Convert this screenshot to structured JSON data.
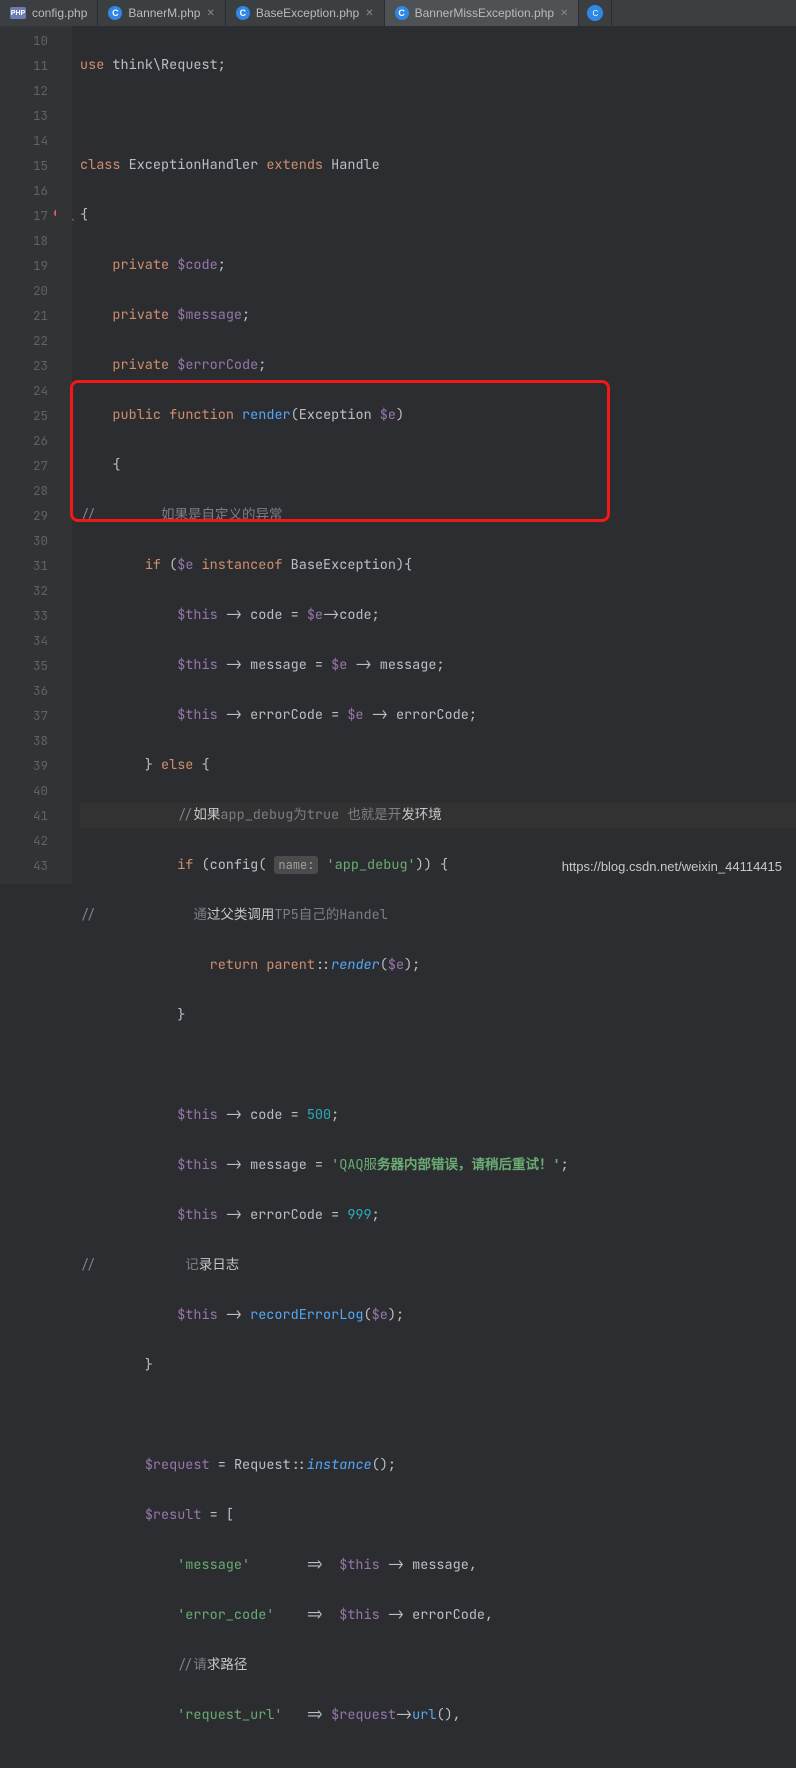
{
  "tabs": {
    "items": [
      {
        "label": "config.php",
        "icon": "php"
      },
      {
        "label": "BannerM.php",
        "icon": "c"
      },
      {
        "label": "BaseException.php",
        "icon": "c"
      },
      {
        "label": "BannerMissException.php",
        "icon": "c"
      }
    ]
  },
  "gutter": {
    "start": 10,
    "end": 43
  },
  "code": {
    "l10": {
      "use": "use",
      "ns": "think\\Request",
      "sc": ";"
    },
    "l12": {
      "class": "class",
      "name": "ExceptionHandler",
      "ext": "extends",
      "parent": "Handle"
    },
    "l14": {
      "mod": "private",
      "v": "$code",
      "sc": ";"
    },
    "l15": {
      "mod": "private",
      "v": "$message",
      "sc": ";"
    },
    "l16": {
      "mod": "private",
      "v": "$errorCode",
      "sc": ";"
    },
    "l17": {
      "mod": "public",
      "fn": "function",
      "name": "render",
      "p1": "Exception",
      "p2": "$e"
    },
    "l19": {
      "c": "//        如果是自定义的异常"
    },
    "l20": {
      "if": "if",
      "v": "$e",
      "inst": "instanceof",
      "cls": "BaseException"
    },
    "l21": {
      "this": "$this",
      "arr": "->",
      "p": "code",
      "eq": "=",
      "v": "$e",
      "p2": "code",
      "sc": ";"
    },
    "l22": {
      "this": "$this",
      "arr": "->",
      "p": "message",
      "eq": "=",
      "v": "$e",
      "p2": "message",
      "sc": ";"
    },
    "l23": {
      "this": "$this",
      "arr": "->",
      "p": "errorCode",
      "eq": "=",
      "v": "$e",
      "p2": "errorCode",
      "sc": ";"
    },
    "l24": {
      "else": "else"
    },
    "l25": {
      "c1": "//",
      "c2": "如果",
      "c3": "app_debug为true 也就是开",
      "c4": "发环境"
    },
    "l26": {
      "if": "if",
      "cfg": "config",
      "hint": "name:",
      "arg": "'app_debug'"
    },
    "l27": {
      "c": "//            通",
      "c2": "过父类调用",
      "c3": "TP5自己的",
      "c4": "Handel"
    },
    "l28": {
      "ret": "return",
      "par": "parent",
      "r": "render",
      "v": "$e",
      "sc": ";"
    },
    "l31": {
      "this": "$this",
      "p": "code",
      "eq": "=",
      "n": "500",
      "sc": ";"
    },
    "l32": {
      "this": "$this",
      "p": "message",
      "eq": "=",
      "s": "'QAQ服",
      "s2": "务器内部错误，请",
      "s3": "稍后重试！'",
      "sc": ";"
    },
    "l33": {
      "this": "$this",
      "p": "errorCode",
      "eq": "=",
      "n": "999",
      "sc": ";"
    },
    "l34": {
      "c": "//           记",
      "c2": "录日志"
    },
    "l35": {
      "this": "$this",
      "fn": "recordErrorLog",
      "v": "$e",
      "sc": ";"
    },
    "l38": {
      "v": "$request",
      "eq": "=",
      "cls": "Request",
      "m": "instance",
      "sc": ";"
    },
    "l39": {
      "v": "$result",
      "eq": "="
    },
    "l40": {
      "k": "'message'",
      "arr": "=>",
      "this": "$this",
      "p": "message"
    },
    "l41": {
      "k": "'error_code'",
      "arr": "=>",
      "this": "$this",
      "p": "errorCode"
    },
    "l42": {
      "c": "//请",
      "c2": "求路径"
    },
    "l43": {
      "k": "'request_url'",
      "arr": "=>",
      "v": "$request",
      "fn": "url"
    }
  },
  "watermark": "https://blog.csdn.net/weixin_44114415"
}
